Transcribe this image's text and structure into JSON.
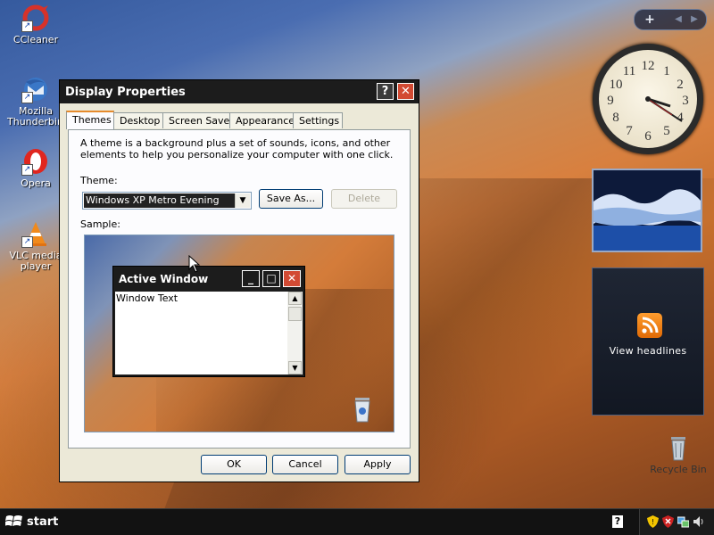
{
  "desktop": {
    "icons": [
      {
        "label": "CCleaner",
        "icon": "ccleaner-icon"
      },
      {
        "label": "Mozilla Thunderbird",
        "icon": "thunderbird-icon"
      },
      {
        "label": "Opera",
        "icon": "opera-icon"
      },
      {
        "label": "VLC media player",
        "icon": "vlc-icon"
      },
      {
        "label": "Recycle Bin",
        "icon": "recycle-bin-icon"
      }
    ]
  },
  "sidebar": {
    "add_symbol": "+",
    "prev_symbol": "◀",
    "next_symbol": "▶",
    "clock": {
      "time": "3:20"
    },
    "feed_label": "View headlines"
  },
  "dialog": {
    "title": "Display Properties",
    "help_symbol": "?",
    "close_symbol": "✕",
    "tabs": [
      "Themes",
      "Desktop",
      "Screen Saver",
      "Appearance",
      "Settings"
    ],
    "active_tab": "Themes",
    "description": "A theme is a background plus a set of sounds, icons, and other elements to help you personalize your computer with one click.",
    "theme_label": "Theme:",
    "theme_value": "Windows XP Metro Evening",
    "save_as_label": "Save As...",
    "delete_label": "Delete",
    "sample_label": "Sample:",
    "sample_window": {
      "title": "Active Window",
      "body_text": "Window Text",
      "minimize_symbol": "_",
      "maximize_symbol": "□",
      "close_symbol": "✕"
    },
    "ok_label": "OK",
    "cancel_label": "Cancel",
    "apply_label": "Apply"
  },
  "taskbar": {
    "start_label": "start",
    "help_symbol": "?"
  },
  "colors": {
    "title_bar": "#1c1c1c",
    "close_button": "#d24a33",
    "tab_highlight": "#e68b2c",
    "rss_orange": "#f28a1a"
  }
}
